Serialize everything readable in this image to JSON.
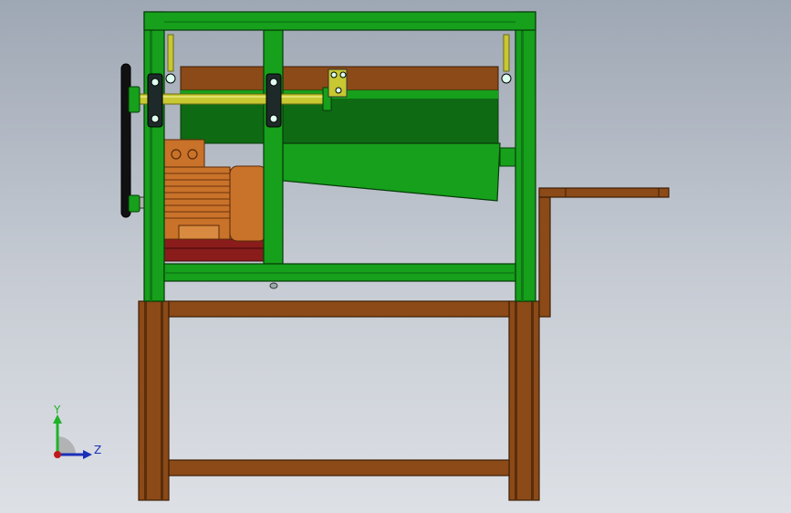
{
  "viewport": {
    "background_top": "#9ea7b4",
    "background_bottom": "#dde0e5"
  },
  "colors": {
    "frame_green": "#16a01b",
    "frame_green_dark": "#0b5e0f",
    "wood_brown": "#8b4a17",
    "wood_dark": "#4a2508",
    "motor_orange": "#c9722a",
    "motor_dark": "#7a3d0e",
    "shaft_yellow": "#c7c832",
    "bearing_dark": "#1e2a2a",
    "belt_black": "#111111",
    "base_red": "#8a1c1c"
  },
  "triad": {
    "x_label": "",
    "y_label": "Y",
    "z_label": "Z",
    "y_color": "#1fb32a",
    "z_color": "#1a2fb8",
    "x_color": "#c01818",
    "sphere_color": "#a0a0a0"
  }
}
